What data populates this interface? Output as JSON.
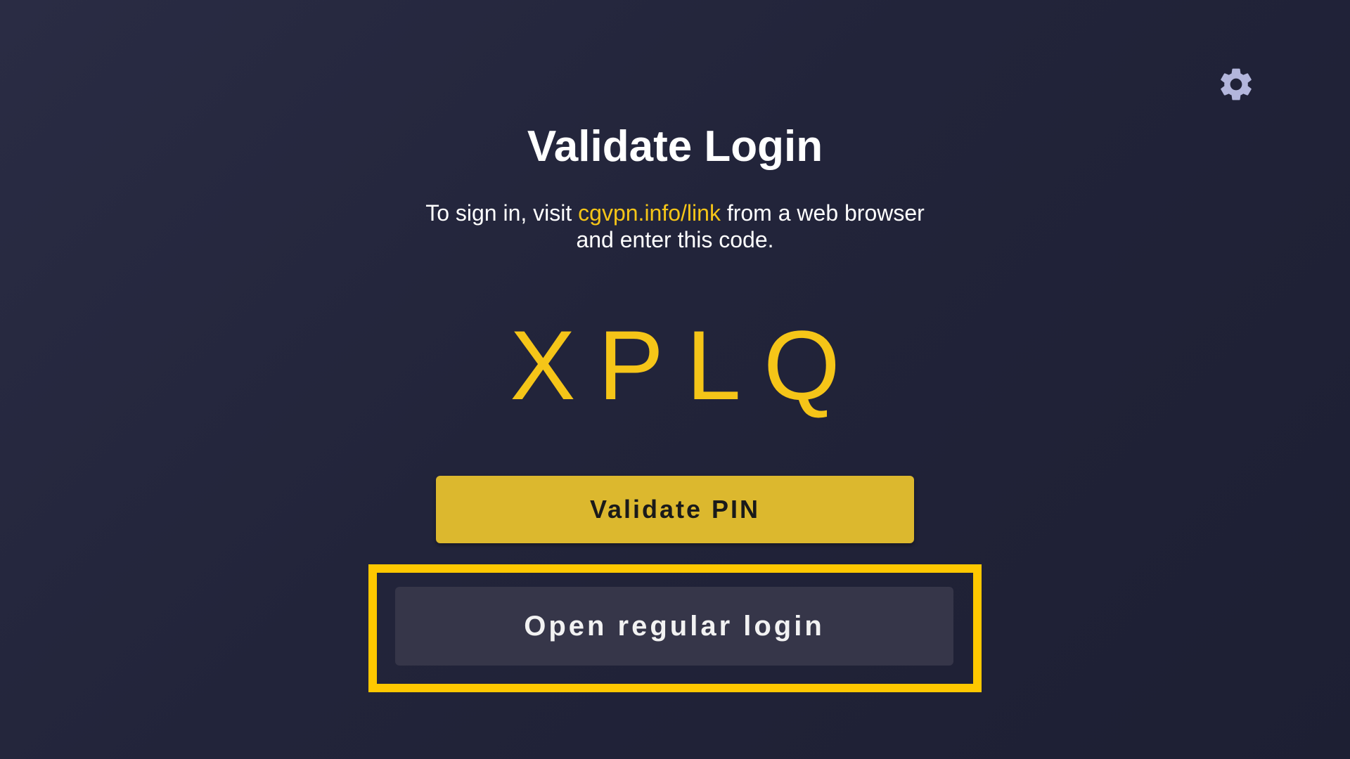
{
  "header": {
    "settings_icon": "gear-icon",
    "icon_color": "#b3b6dc"
  },
  "main": {
    "title": "Validate Login",
    "instructions": {
      "before_link": "To sign in, visit ",
      "link_text": "cgvpn.info/link",
      "after_link": " from a web browser",
      "line2": "and enter this code."
    },
    "code": "XPLQ",
    "validate_button_label": "Validate PIN",
    "regular_login_button_label": "Open regular login"
  },
  "colors": {
    "accent": "#f5c518",
    "validate_button_bg": "#dcb82e",
    "secondary_button_bg": "#363649",
    "focus_highlight": "#ffc800",
    "background": "#24263b"
  }
}
